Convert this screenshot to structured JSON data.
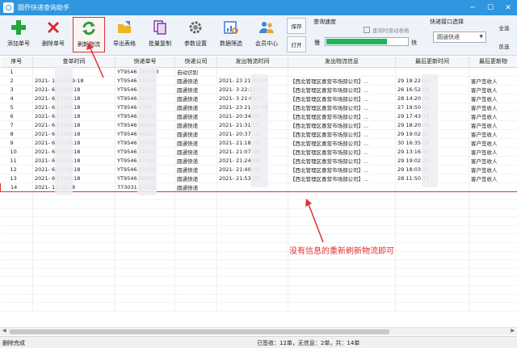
{
  "window": {
    "title": "圆乔快递查询助手",
    "minimize": "─",
    "maximize": "☐",
    "close": "✕"
  },
  "toolbar": {
    "buttons": [
      {
        "label": "添加单号",
        "icon": "plus-icon"
      },
      {
        "label": "删除单号",
        "icon": "delete-x-icon"
      },
      {
        "label": "刷新物流",
        "icon": "refresh-icon"
      },
      {
        "label": "导出表格",
        "icon": "export-icon"
      },
      {
        "label": "批量复制",
        "icon": "copy-icon"
      },
      {
        "label": "参数设置",
        "icon": "gear-icon"
      },
      {
        "label": "数据筛选",
        "icon": "filter-icon"
      },
      {
        "label": "会员中心",
        "icon": "members-icon"
      }
    ],
    "save": "保存",
    "open": "打开"
  },
  "speed": {
    "header": "查询速度",
    "checkbox": "查询时滚动表格",
    "slow": "慢",
    "fast": "快",
    "level": 0.74
  },
  "port": {
    "header": "快递接口选择",
    "selected": "圆通快递"
  },
  "side": {
    "select_all": "全选",
    "invert": "反选"
  },
  "table": {
    "columns": [
      "序号",
      "查单时间",
      "快递单号",
      "快递公司",
      "发出物流时间",
      "发出物流信息",
      "最后更新时间",
      "最后更新物"
    ],
    "rows": [
      [
        "1",
        "",
        "YT9546 740583",
        "自动识别",
        "",
        "",
        "",
        ""
      ],
      [
        "2",
        "2021- 16 13:39:18",
        "YT9546 15514",
        "圆通快递",
        "2021- 23 21:34:29",
        "【西北管理区喜营市场部公司】...",
        "29 18:22:03",
        "客户签收人"
      ],
      [
        "3",
        "2021- 6 13:39:18",
        "YT9546 01230",
        "圆通快递",
        "2021- 3 22:35:17",
        "【西北管理区喜营市场部公司】...",
        "26 16:52:08",
        "客户签收人"
      ],
      [
        "4",
        "2021- 6 13:39:18",
        "YT9546 41041",
        "圆通快递",
        "2021- 3 21:05:51",
        "【西北管理区喜营市场部公司】...",
        "28 14:20:39",
        "客户签收人"
      ],
      [
        "5",
        "2021- 6 13:39:18",
        "YT9546 4367",
        "圆通快递",
        "2021- 23 21:05:09",
        "【西北管理区喜营市场部公司】...",
        "27 19:50:01",
        "客户签收人"
      ],
      [
        "6",
        "2021- 6 13:39:18",
        "YT9546 61932",
        "圆通快递",
        "2021- 20:34:58",
        "【西北管理区喜营市场部公司】...",
        "29 17:43:19",
        "客户签收人"
      ],
      [
        "7",
        "2021- 6 13:39:18",
        "YT9546 60255",
        "圆通快递",
        "2021- 21:31:00",
        "【西北管理区喜营市场部公司】...",
        "29 18:20:29",
        "客户签收人"
      ],
      [
        "8",
        "2021- 6 13:39:18",
        "YT9546 34182",
        "圆通快递",
        "2021- 20:37:15",
        "【西北管理区喜营市场部公司】...",
        "29 19:02:22",
        "客户签收人"
      ],
      [
        "9",
        "2021- 6 13:39:18",
        "YT9546 76009",
        "圆通快递",
        "2021- 21:18:32",
        "【西北管理区喜营市场部公司】...",
        "30 16:35:26",
        "客户签收人"
      ],
      [
        "10",
        "2021- 6 13:39:18",
        "YT9546 32467",
        "圆通快递",
        "2021- 21:07:48",
        "【西北管理区喜营市场部公司】...",
        "29 13:16:56",
        "客户签收人"
      ],
      [
        "11",
        "2021- 6 13:39:18",
        "YT9546 47192",
        "圆通快递",
        "2021- 21:24:06",
        "【西北管理区喜营市场部公司】...",
        "29 19:02:21",
        "客户签收人"
      ],
      [
        "12",
        "2021- 6 13:39:18",
        "YT9546 15659",
        "圆通快递",
        "2021- 21:40:03",
        "【西北管理区喜营市场部公司】...",
        "29 18:03:14",
        "客户签收人"
      ],
      [
        "13",
        "2021- 6 13:39:18",
        "YT9546 69498",
        "圆通快递",
        "2021- 21:53:25",
        "【西北管理区喜营市场部公司】...",
        "28 11:50:11",
        "客户签收人"
      ],
      [
        "14",
        "2021- 13:39:18",
        "773031 57315",
        "圆通快递",
        "",
        "",
        "",
        ""
      ]
    ]
  },
  "annotation": "没有信息的重新刷新物流即可",
  "status": {
    "left": "删除完成",
    "right": "已签收：12单，无信息：2单，共：14单"
  },
  "colors": {
    "titlebar": "#2f96e0",
    "highlight": "#e03030",
    "progress": "#1fb45b"
  }
}
